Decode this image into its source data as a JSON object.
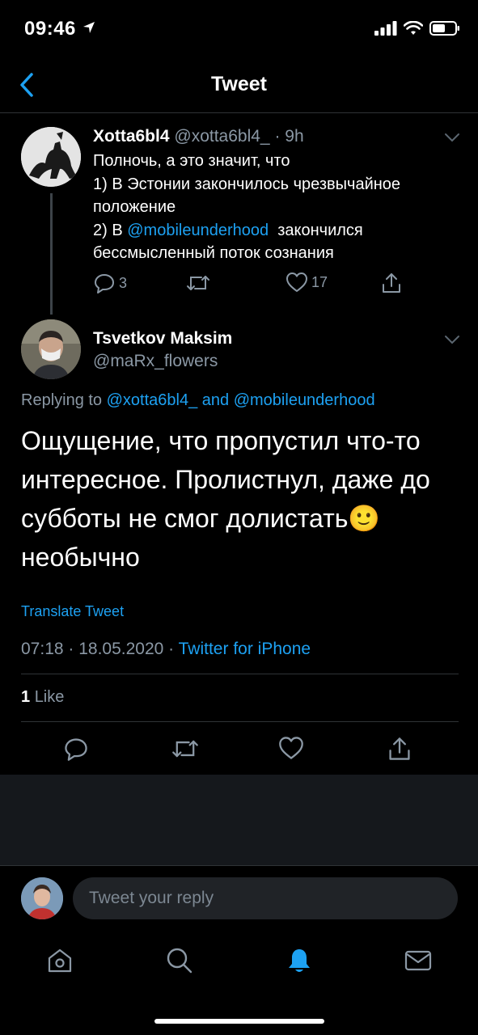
{
  "status_bar": {
    "time": "09:46"
  },
  "nav": {
    "title": "Tweet"
  },
  "parent_tweet": {
    "name": "Xotta6bl4",
    "handle": "@xotta6bl4_",
    "separator": " · ",
    "age": "9h",
    "body_line1": "Полночь, а это значит, что",
    "body_line2": "1) В Эстонии закончилось чрезвычайное положение",
    "body_line3_prefix": "2) В ",
    "body_line3_mention": "@mobileunderhood",
    "body_line3_suffix": "  закончился бессмысленный поток сознания",
    "reply_count": "3",
    "like_count": "17"
  },
  "main_tweet": {
    "name": "Tsvetkov Maksim",
    "handle": "@maRx_flowers",
    "replying_prefix": "Replying to ",
    "replying_mention1": "@xotta6bl4_",
    "replying_and": " and ",
    "replying_mention2": "@mobileunderhood",
    "text": "Ощущение, что пропустил что-то интересное. Пролистнул, даже до субботы не смог долистать🙂 необычно",
    "translate_label": "Translate Tweet",
    "time": "07:18",
    "date": "18.05.2020",
    "dot": " · ",
    "source": "Twitter for iPhone",
    "likes_count": "1",
    "likes_label": "Like"
  },
  "reply_bar": {
    "placeholder": "Tweet your reply"
  },
  "colors": {
    "accent": "#1da1f2",
    "background": "#000000",
    "muted": "#8b98a5"
  }
}
